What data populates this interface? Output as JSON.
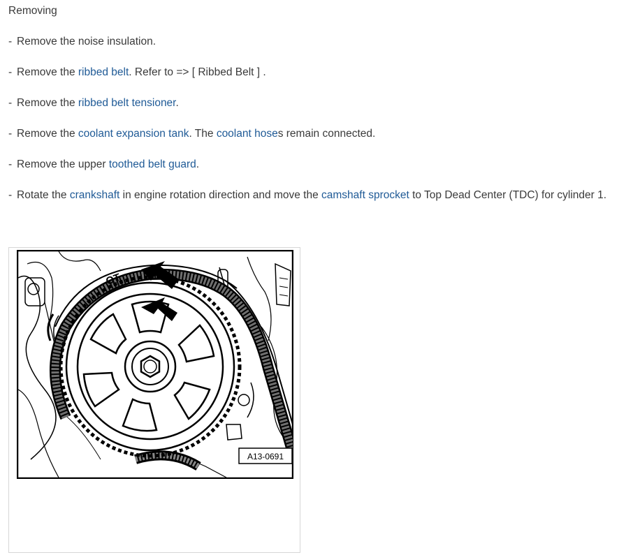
{
  "heading": "Removing",
  "steps": [
    {
      "parts": [
        {
          "t": "Remove the noise insulation."
        }
      ]
    },
    {
      "parts": [
        {
          "t": "Remove the "
        },
        {
          "t": "ribbed belt",
          "link": true
        },
        {
          "t": ". Refer to => [ Ribbed Belt ] ."
        }
      ]
    },
    {
      "parts": [
        {
          "t": "Remove the "
        },
        {
          "t": "ribbed belt tensioner",
          "link": true
        },
        {
          "t": "."
        }
      ]
    },
    {
      "parts": [
        {
          "t": "Remove the "
        },
        {
          "t": "coolant expansion tank",
          "link": true
        },
        {
          "t": ". The "
        },
        {
          "t": "coolant hose",
          "link": true
        },
        {
          "t": "s remain connected."
        }
      ]
    },
    {
      "parts": [
        {
          "t": "Remove the upper "
        },
        {
          "t": "toothed belt guard",
          "link": true
        },
        {
          "t": "."
        }
      ]
    },
    {
      "parts": [
        {
          "t": "Rotate the "
        },
        {
          "t": "crankshaft",
          "link": true
        },
        {
          "t": " in engine rotation direction and move the "
        },
        {
          "t": "camshaft sprocket",
          "link": true
        },
        {
          "t": " to Top Dead Center (TDC) for cylinder 1."
        }
      ]
    }
  ],
  "figure": {
    "label": "A13-0691",
    "sprocket_mark": "OT",
    "colors": {
      "link": "#1f5a96",
      "text": "#3a3a3a"
    }
  }
}
